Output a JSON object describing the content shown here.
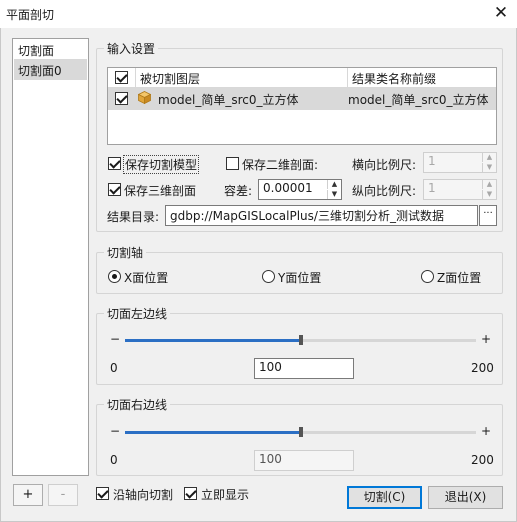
{
  "window": {
    "title": "平面剖切"
  },
  "sidebar": {
    "header": "切割面",
    "items": [
      "切割面0"
    ],
    "add_label": "+",
    "remove_label": "-"
  },
  "input_settings": {
    "legend": "输入设置",
    "table": {
      "col_cut_layer": "被切割图层",
      "col_result_prefix": "结果类名称前缀",
      "rows": [
        {
          "checked": true,
          "layer": "model_简单_src0_立方体",
          "prefix": "model_简单_src0_立方体"
        }
      ]
    },
    "save_cut_model": {
      "label": "保存切割模型",
      "checked": true
    },
    "save_2d_section": {
      "label": "保存二维剖面:",
      "checked": false
    },
    "h_scale": {
      "label": "横向比例尺:",
      "value": "1"
    },
    "save_3d_section": {
      "label": "保存三维剖面",
      "checked": true
    },
    "tolerance": {
      "label": "容差:",
      "value": "0.00001"
    },
    "v_scale": {
      "label": "纵向比例尺:",
      "value": "1"
    },
    "result_dir": {
      "label": "结果目录:",
      "value": "gdbp://MapGISLocalPlus/三维切割分析_测试数据",
      "browse": "···"
    }
  },
  "cut_axis": {
    "legend": "切割轴",
    "options": [
      {
        "label": "X面位置",
        "selected": true
      },
      {
        "label": "Y面位置",
        "selected": false
      },
      {
        "label": "Z面位置",
        "selected": false
      }
    ]
  },
  "left_edge": {
    "legend": "切面左边线",
    "min": "0",
    "max": "200",
    "value": "100",
    "fraction": 0.5,
    "minus": "−",
    "plus": "+"
  },
  "right_edge": {
    "legend": "切面右边线",
    "min": "0",
    "max": "200",
    "value": "100",
    "fraction": 0.5,
    "minus": "−",
    "plus": "+"
  },
  "footer": {
    "cut_along_axis": {
      "label": "沿轴向切割",
      "checked": true
    },
    "show_immediately": {
      "label": "立即显示",
      "checked": true
    },
    "cut_button": "切割(C)",
    "exit_button": "退出(X)"
  }
}
